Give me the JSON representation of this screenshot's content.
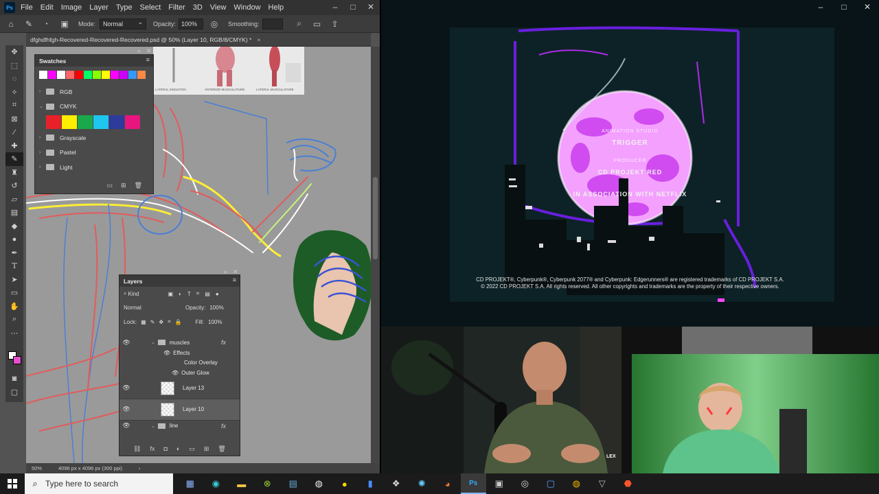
{
  "photoshop": {
    "logo": "Ps",
    "menu": [
      "File",
      "Edit",
      "Image",
      "Layer",
      "Type",
      "Select",
      "Filter",
      "3D",
      "View",
      "Window",
      "Help"
    ],
    "window_controls": [
      "–",
      "□",
      "✕"
    ],
    "options": {
      "mode_label": "Mode:",
      "mode_value": "Normal",
      "opacity_label": "Opacity:",
      "opacity_value": "100%",
      "smoothing_label": "Smoothing:"
    },
    "doc_tab": "dfghdfhfgh-Recovered-Recovered-Recovered.psd @ 50% (Layer 10, RGB/8/CMYK) *",
    "doc_tab_close": "×",
    "reference_captions": [
      "LATERAL SKELETON",
      "ANTERIOR MUSCULATURE",
      "LATERAL MUSCULATURE"
    ],
    "status": {
      "zoom": "50%",
      "doc_size": "4096 px x 4096 px (300 ppi)",
      "arrow": "›"
    }
  },
  "swatches": {
    "title": "Swatches",
    "recent": [
      "#ffffff",
      "#ff00ff",
      "#ffffff",
      "#ff6666",
      "#ff0000",
      "#00ff66",
      "#88ff00",
      "#ffff00",
      "#ff00ff",
      "#cc00ff",
      "#3399ff",
      "#ff8844"
    ],
    "groups": [
      {
        "name": "RGB",
        "expanded": false
      },
      {
        "name": "CMYK",
        "expanded": true
      },
      {
        "name": "Grayscale",
        "expanded": false
      },
      {
        "name": "Pastel",
        "expanded": false
      },
      {
        "name": "Light",
        "expanded": false
      }
    ],
    "cmyk_colors": [
      "#e8202a",
      "#ffee00",
      "#19a94b",
      "#1ec6ef",
      "#2e3a9c",
      "#e8157f"
    ]
  },
  "layers": {
    "title": "Layers",
    "filter_kind": "Kind",
    "blend_mode": "Normal",
    "opacity_label": "Opacity:",
    "opacity_value": "100%",
    "lock_label": "Lock:",
    "fill_label": "Fill:",
    "fill_value": "100%",
    "fx": "fx",
    "rows": {
      "muscles": "muscles",
      "effects": "Effects",
      "color_overlay": "Color Overlay",
      "outer_glow": "Outer Glow",
      "layer13": "Layer 13",
      "layer10": "Layer 10",
      "line": "line"
    }
  },
  "video": {
    "animation_studio_label": "ANIMATION STUDIO",
    "studio": "TRIGGER",
    "producer_label": "PRODUCER",
    "producer": "CD PROJEKT RED",
    "netflix": "IN ASSOCIATION WITH NETFLIX",
    "legal_line1": "CD PROJEKT®, Cyberpunk®, Cyberpunk 2077® and Cyberpunk: Edgerunners® are registered trademarks of CD PROJEKT S.A.",
    "legal_line2": "© 2022 CD PROJEKT S.A. All rights reserved. All other copyrights and trademarks are the property of their respective owners.",
    "window_controls": [
      "–",
      "□",
      "✕"
    ]
  },
  "podcast": {
    "watermark": "LEX"
  },
  "taskbar": {
    "search_placeholder": "Type here to search"
  }
}
